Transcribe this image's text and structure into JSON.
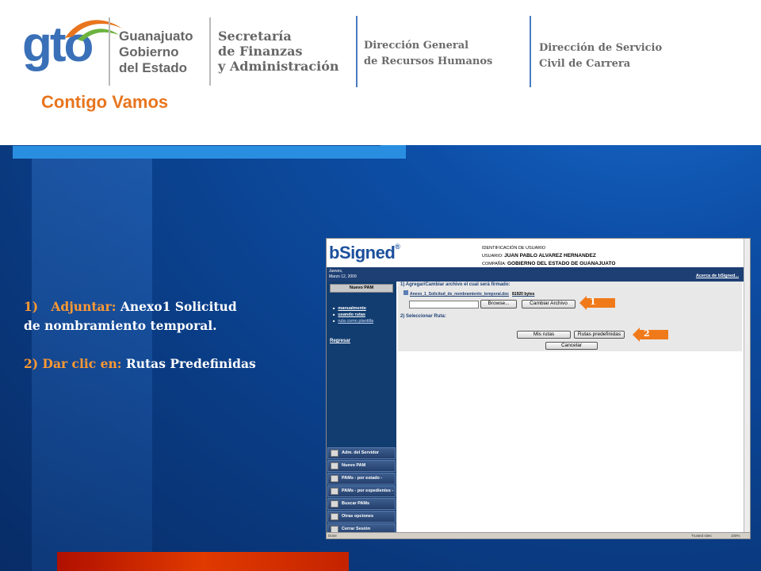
{
  "header": {
    "logo_text": "gto",
    "slogan": "Contigo Vamos",
    "gobierno": [
      "Guanajuato",
      "Gobierno",
      "del Estado"
    ],
    "secretaria": [
      "Secretaría",
      "de Finanzas",
      "y Administración"
    ],
    "direccion_general": [
      "Dirección General",
      "de Recursos Humanos"
    ],
    "direccion_servicio": [
      "Dirección de Servicio",
      "Civil de Carrera"
    ]
  },
  "instructions": {
    "step1_num": "1)",
    "step1_action": "Adjuntar:",
    "step1_text_a": " Anexo1 Solicitud",
    "step1_text_b": "de nombramiento temporal.",
    "step2_action": "2) Dar clic en:",
    "step2_text": " Rutas Predefinidas"
  },
  "app": {
    "brand": "bSigned",
    "brand_mark": "®",
    "identificacion": "IDENTIFICACIÓN DE USUARIO",
    "usuario_label": "USUARIO:",
    "usuario": "JUAN PABLO ALVAREZ HERNANDEZ",
    "compania_label": "COMPAÑÍA:",
    "compania": "GOBIERNO DEL ESTADO DE GUANAJUATO",
    "date_day": "Jueves,",
    "date": "Marzo 12, 2009",
    "acerca": "Acerca de bSigned...",
    "nuevo_pam": "Nuevo PAM",
    "links": [
      "manualmente",
      "usando rutas",
      "ruta como plantilla"
    ],
    "regresar": "Regresar",
    "menu": [
      "Adm. del Servidor",
      "Nuevo PAM",
      "PAMs - por estado -",
      "PAMs - por expedientes -",
      "Buscar PAMs",
      "Otras opciones",
      "Cerrar Sesión"
    ],
    "step1_title": "1) Agregar/Cambiar archivo el cual será firmado:",
    "file_name": "Anexo_1_Solicitud_de_nombramiento_temporal.doc",
    "file_size": "81920 bytes",
    "browse": "Browse...",
    "cambiar_archivo": "Cambiar Archivo",
    "step2_title": "2) Seleccionar Ruta:",
    "mis_rutas": "Mis rutas",
    "rutas_predefinidas": "Rutas predefinidas",
    "cancelar": "Cancelar",
    "status_left": "Done",
    "status_right": "Trusted sites",
    "zoom": "100%"
  },
  "callouts": [
    "1",
    "2"
  ],
  "colors": {
    "header_bg": "#ffffff",
    "orange_text": "#ff9933",
    "callout": "#f07a1a",
    "slide_blue": "#0d4fa8",
    "red_bar": "#e13a00"
  }
}
